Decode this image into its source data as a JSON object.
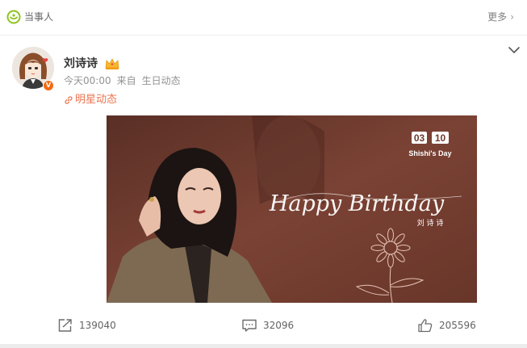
{
  "header": {
    "tag_label": "当事人",
    "more_label": "更多",
    "more_chevron": "›"
  },
  "post": {
    "author": "刘诗诗",
    "time": "今天00:00",
    "source_prefix": "来自",
    "source": "生日动态",
    "topic": "明星动态",
    "verified_badge": "V"
  },
  "image": {
    "date_month": "03",
    "date_day": "10",
    "date_caption": "Shishi's Day",
    "script_text": "Happy Birthday",
    "name_caption": "刘 诗 诗"
  },
  "actions": {
    "share_count": "139040",
    "comment_count": "32096",
    "like_count": "205596"
  },
  "colors": {
    "accent": "#eb7350",
    "verified": "#f16a12",
    "photo_bg": "#6d3a2f"
  }
}
